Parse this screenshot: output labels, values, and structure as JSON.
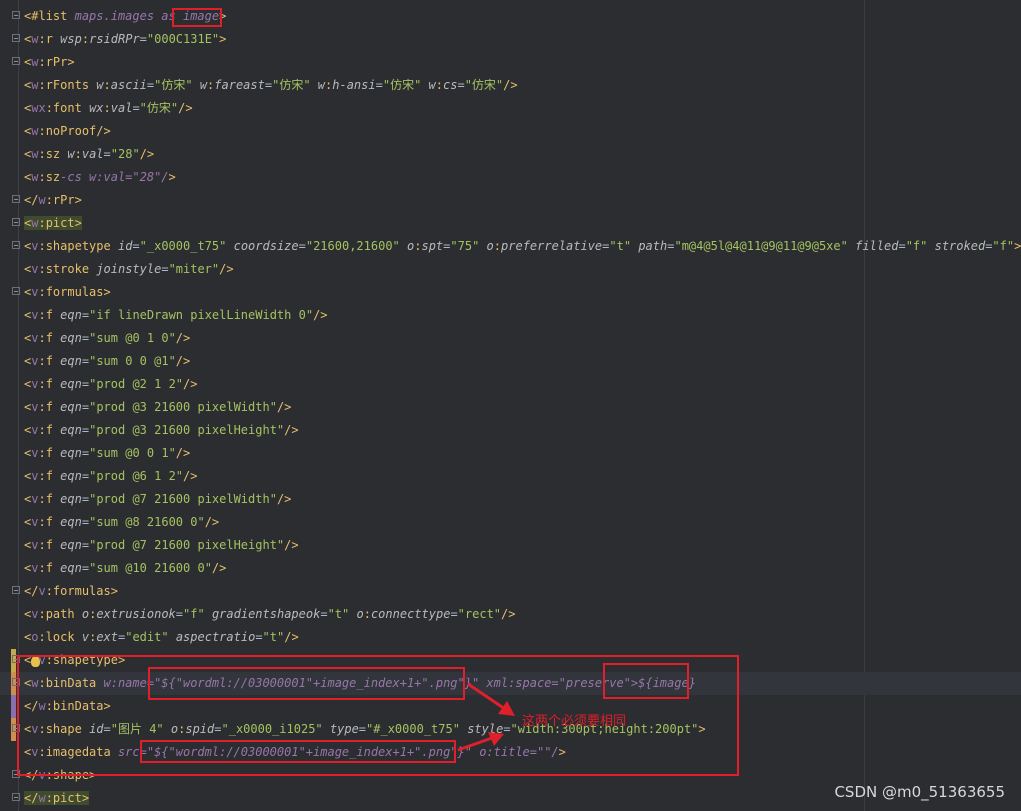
{
  "lines": [
    "<#list maps.images as image>",
    "<w:r wsp:rsidRPr=\"000C131E\">",
    "<w:rPr>",
    "<w:rFonts w:ascii=\"仿宋\" w:fareast=\"仿宋\" w:h-ansi=\"仿宋\" w:cs=\"仿宋\"/>",
    "<wx:font wx:val=\"仿宋\"/>",
    "<w:noProof/>",
    "<w:sz w:val=\"28\"/>",
    "<w:sz-cs w:val=\"28\"/>",
    "</w:rPr>",
    "<w:pict>",
    "<v:shapetype id=\"_x0000_t75\" coordsize=\"21600,21600\" o:spt=\"75\" o:preferrelative=\"t\" path=\"m@4@5l@4@11@9@11@9@5xe\" filled=\"f\" stroked=\"f\">",
    "<v:stroke joinstyle=\"miter\"/>",
    "<v:formulas>",
    "<v:f eqn=\"if lineDrawn pixelLineWidth 0\"/>",
    "<v:f eqn=\"sum @0 1 0\"/>",
    "<v:f eqn=\"sum 0 0 @1\"/>",
    "<v:f eqn=\"prod @2 1 2\"/>",
    "<v:f eqn=\"prod @3 21600 pixelWidth\"/>",
    "<v:f eqn=\"prod @3 21600 pixelHeight\"/>",
    "<v:f eqn=\"sum @0 0 1\"/>",
    "<v:f eqn=\"prod @6 1 2\"/>",
    "<v:f eqn=\"prod @7 21600 pixelWidth\"/>",
    "<v:f eqn=\"sum @8 21600 0\"/>",
    "<v:f eqn=\"prod @7 21600 pixelHeight\"/>",
    "<v:f eqn=\"sum @10 21600 0\"/>",
    "</v:formulas>",
    "<v:path o:extrusionok=\"f\" gradientshapeok=\"t\" o:connecttype=\"rect\"/>",
    "<o:lock v:ext=\"edit\" aspectratio=\"t\"/>",
    "</v:shapetype>",
    "<w:binData w:name=\"${\"wordml://03000001\"+image_index+1+\".png\"}\" xml:space=\"preserve\">${image}",
    "</w:binData>",
    "<v:shape id=\"图片 4\" o:spid=\"_x0000_i1025\" type=\"#_x0000_t75\" style=\"width:300pt;height:200pt\">",
    "<v:imagedata src=\"${\"wordml://03000001\"+image_index+1+\".png\"}\" o:title=\"\"/>",
    "</v:shape>",
    "</w:pict>"
  ],
  "annotation": "这两个必须要相同",
  "watermark": "CSDN @m0_51363655",
  "colors": {
    "background": "#2b2d31",
    "tag": "#e8bf6a",
    "namespace": "#9876aa",
    "attribute_value": "#6a8759",
    "annotation_red": "#e01f2a"
  },
  "icons": [
    "fold-toggle-icon",
    "lightbulb-icon",
    "red-arrow-icon"
  ]
}
